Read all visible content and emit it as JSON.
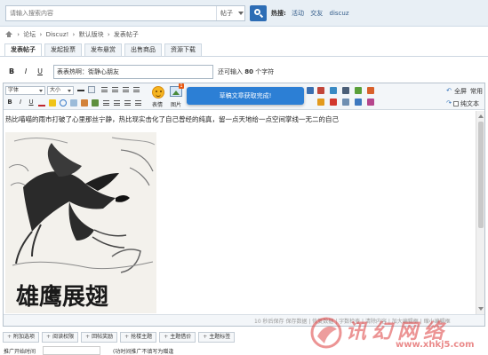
{
  "search": {
    "placeholder": "请输入搜索内容",
    "scope": "帖子",
    "hot_label": "热搜:",
    "hot_links": [
      "活动",
      "交友",
      "discuz"
    ]
  },
  "breadcrumb": {
    "items": [
      "›",
      "论坛",
      "›",
      "Discuz!",
      "›",
      "默认版块",
      "›",
      "发表帖子"
    ]
  },
  "tabs": [
    {
      "label": "发表帖子",
      "active": true
    },
    {
      "label": "发起投票",
      "active": false
    },
    {
      "label": "发布悬赏",
      "active": false
    },
    {
      "label": "出售商品",
      "active": false
    },
    {
      "label": "资源下载",
      "active": false
    }
  ],
  "subject": {
    "bold": "B",
    "italic": "I",
    "underline": "U",
    "value": "表表热啊：街静心朋友",
    "hint_prefix": "还可输入",
    "hint_count": "80",
    "hint_suffix": "个字符"
  },
  "toolbar": {
    "font_select": "字体",
    "size_select": "大小",
    "emoji_label": "表情",
    "image_label": "图片",
    "image_badge": "1",
    "toast": "草稿文章获取完成!",
    "full_label": "全屏",
    "common_label": "常用",
    "plain_label": "纯文本"
  },
  "editor": {
    "content_text": "热比喵喵的雨市打破了心里那丝宁静，热比现实击化了自己曾经的纯真，留一点天地给一点空间掌线一无二的自己",
    "drawing_caption": "雄鹰展翅",
    "status_text": "10 秒后保存  保存数据 | 恢复数据 | 字数检查 | 清除内容 | 加大编辑框 | 缩小编辑框"
  },
  "options": [
    "附加选项",
    "阅读权限",
    "回帖奖励",
    "抢楼主题",
    "主题借价",
    "主题标签"
  ],
  "bottom": {
    "label": "推广开始时间",
    "mid_text": "(功时间推广不填写为赠逢"
  },
  "watermark": {
    "text": "讯幻网络",
    "url": "www.xhkj5.com"
  },
  "colors": {
    "accent": "#2d6db5",
    "toast_bg": "#2c7fd5",
    "watermark": "#dc3c3c"
  }
}
